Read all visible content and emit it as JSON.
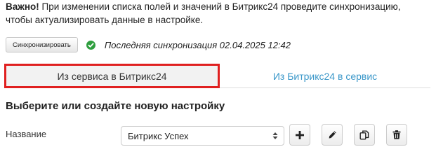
{
  "notice": {
    "bold": "Важно!",
    "text": " При изменении списка полей и значений в Битрикс24 проведите синхронизацию, чтобы актуализировать данные в настройке."
  },
  "sync": {
    "button_label": "Синхронизировать",
    "status_icon": "check-circle-icon",
    "status_text": "Последняя синхронизация 02.04.2025 12:42"
  },
  "tabs": [
    {
      "label": "Из сервиса в Битрикс24",
      "active": true
    },
    {
      "label": "Из Битрикс24 в сервис",
      "active": false
    }
  ],
  "section": {
    "title": "Выберите или создайте новую настройку"
  },
  "setting": {
    "label": "Название",
    "selected": "Битрикс Успех"
  },
  "actions": [
    {
      "name": "add-button",
      "icon": "plus-icon"
    },
    {
      "name": "edit-button",
      "icon": "pencil-icon"
    },
    {
      "name": "copy-button",
      "icon": "copy-icon"
    },
    {
      "name": "delete-button",
      "icon": "trash-icon"
    }
  ],
  "colors": {
    "highlight_border": "#e02020",
    "link": "#3a97c9",
    "success": "#2e9e3e"
  }
}
